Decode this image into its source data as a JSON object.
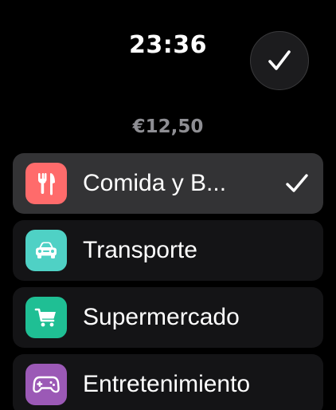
{
  "status": {
    "time": "23:36"
  },
  "header": {
    "confirm_icon": "checkmark-icon"
  },
  "expense": {
    "amount": "€12,50"
  },
  "categories": [
    {
      "label": "Comida y B...",
      "icon": "fork-knife-icon",
      "color": "#ff6b6b",
      "selected": true
    },
    {
      "label": "Transporte",
      "icon": "car-icon",
      "color": "#4fd1c5",
      "selected": false
    },
    {
      "label": "Supermercado",
      "icon": "shopping-cart-icon",
      "color": "#1fbf94",
      "selected": false
    },
    {
      "label": "Entretenimiento",
      "icon": "gamepad-icon",
      "color": "#9b59b6",
      "selected": false
    }
  ],
  "colors": {
    "background": "#000000",
    "row_background": "#141416",
    "selected_row_background": "#333335",
    "amount_text": "#8e8e93"
  }
}
